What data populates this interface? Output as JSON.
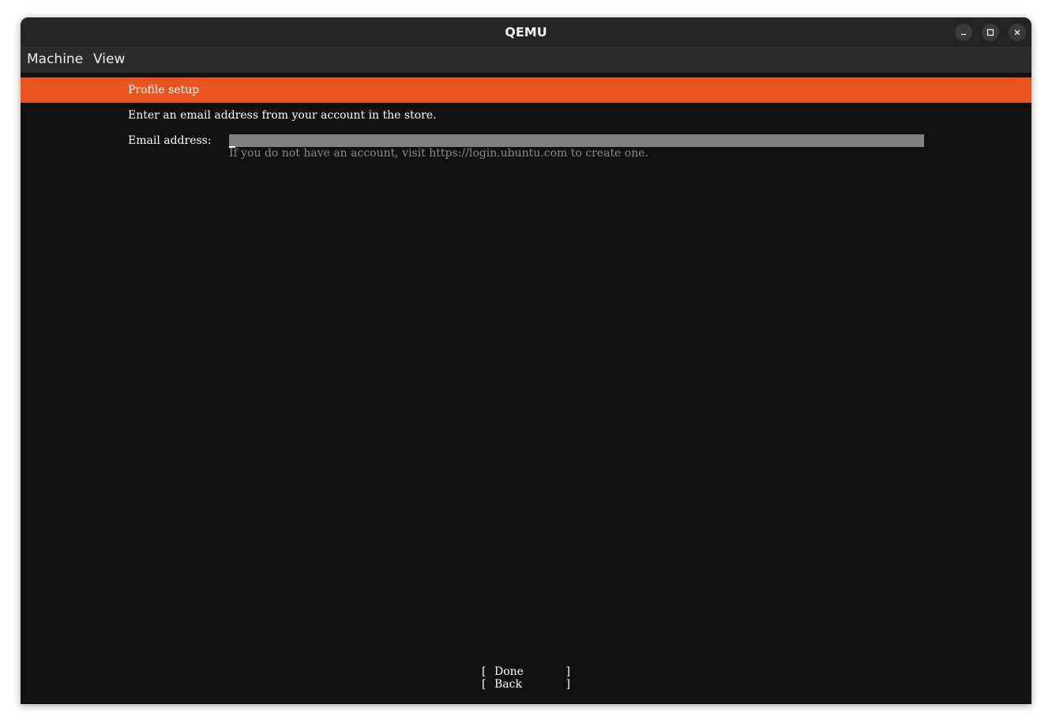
{
  "window": {
    "title": "QEMU",
    "controls": {
      "minimize_icon": "minimize-icon",
      "maximize_icon": "maximize-icon",
      "close_icon": "close-icon"
    }
  },
  "menubar": {
    "items": [
      {
        "label": "Machine"
      },
      {
        "label": "View"
      }
    ]
  },
  "installer": {
    "header": "Profile setup",
    "instruction": "Enter an email address from your account in the store.",
    "email": {
      "label": "Email address:",
      "value": "",
      "hint": "If you do not have an account, visit https://login.ubuntu.com to create one."
    },
    "buttons": {
      "bracket_open": "[",
      "bracket_close": "]",
      "done_label": "Done",
      "back_label": "Back"
    },
    "colors": {
      "accent": "#e95420",
      "background": "#111111",
      "input_field": "#808080",
      "hint_text": "#8a8a8a"
    }
  }
}
